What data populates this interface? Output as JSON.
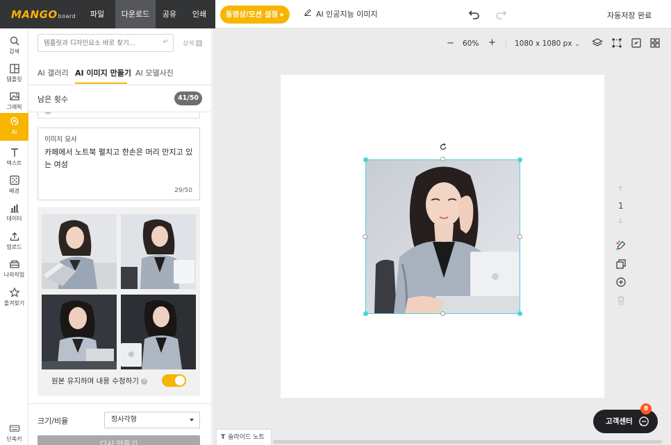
{
  "header": {
    "logo_main": "MANGO",
    "logo_sub": "board",
    "menus": [
      "파일",
      "다운로드",
      "공유",
      "인쇄"
    ],
    "video_motion_label": "동영상/모션 설정 ▸",
    "ai_image_label": "AI 인공지능 이미지",
    "autosave_label": "자동저장 완료"
  },
  "rail": {
    "items": [
      {
        "label": "검색",
        "icon": "search-icon"
      },
      {
        "label": "템플릿",
        "icon": "template-icon"
      },
      {
        "label": "그래픽",
        "icon": "graphic-icon"
      },
      {
        "label": "AI",
        "icon": "ai-icon"
      },
      {
        "label": "텍스트",
        "icon": "text-icon"
      },
      {
        "label": "배경",
        "icon": "background-icon"
      },
      {
        "label": "데이터",
        "icon": "data-chart-icon"
      },
      {
        "label": "업로드",
        "icon": "upload-icon"
      },
      {
        "label": "나의작업",
        "icon": "my-work-icon"
      },
      {
        "label": "즐겨찾기",
        "icon": "star-icon"
      }
    ],
    "shortcut_label": "단축키"
  },
  "panel": {
    "search_placeholder": "템플릿과 디자인요소 바로 찾기...",
    "enter_symbol": "↵",
    "detail_label": "상세",
    "tabs": [
      "AI 갤러리",
      "AI 이미지 만들기",
      "AI 모델사진"
    ],
    "remaining_label": "남은 횟수",
    "remaining_count": "41/50",
    "description_title": "이미지 묘사",
    "description_text": "카페에서 노트북 펼치고 한손은 머리 만지고 있는 여성",
    "description_count": "29/50",
    "keep_original_label": "원본 유지하며 내용 수정하기",
    "keep_original_on": true,
    "help_glyph": "?",
    "size_label": "크기/비율",
    "size_value": "정사각형",
    "generate_label": "다시 만들기"
  },
  "toolbar": {
    "zoom_minus": "−",
    "zoom_value": "60%",
    "zoom_plus": "+",
    "canvas_size": "1080 x 1080 px",
    "canvas_chevron": "⌄"
  },
  "page_nav": {
    "up": "↑",
    "current": "1",
    "down": "↓"
  },
  "help": {
    "label": "고객센터",
    "badge": "8"
  },
  "slide_note": {
    "icon_text": "T",
    "label": "슬라이드 노트"
  },
  "colors": {
    "accent": "#f7b500",
    "selection": "#4fd3d8",
    "header_dark": "#333436"
  }
}
